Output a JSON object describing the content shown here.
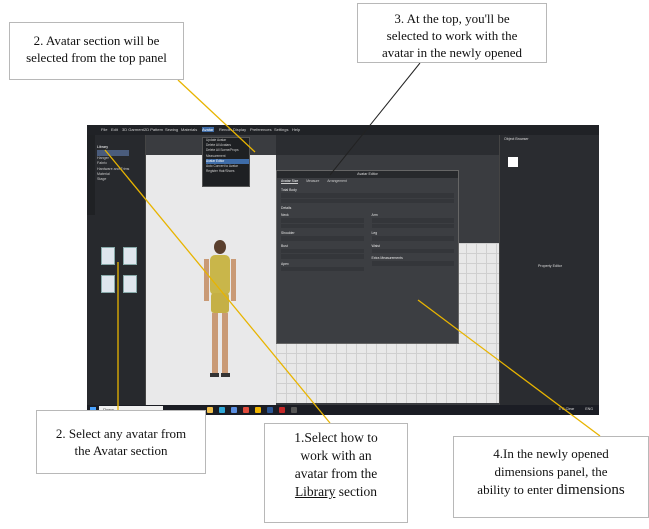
{
  "callouts": {
    "step2": {
      "line1": "2. Avatar section will be",
      "line2": "selected from the top panel"
    },
    "step3": {
      "line1": "3. At the top, you'll be",
      "line2": "selected to work with the",
      "line3": "avatar in the newly opened"
    },
    "select_avatar": {
      "line1": "2. Select any avatar from",
      "line2": "the Avatar section"
    },
    "step1": {
      "line1": "1.Select how to",
      "line2": "work with an",
      "line3": "avatar from the",
      "line4": "Library",
      "line5": "section"
    },
    "step4": {
      "line1": "4.In the newly opened",
      "line2": "dimensions panel, the",
      "line3a": "ability to enter",
      "line3b": "dimensions"
    }
  },
  "app": {
    "menu": [
      "File",
      "Edit",
      "3D Garment",
      "2D Pattern",
      "Sewing",
      "Materials",
      "Avatar",
      "Render",
      "Display",
      "Preferences",
      "Settings",
      "Help"
    ],
    "library_title": "Library",
    "library_items": [
      "Hanger",
      "Fabric",
      "Hardware and Trims",
      "Material",
      "Stage"
    ],
    "avatar_dropdown": [
      "Update Avatar",
      "Delete All Avatars",
      "Delete All Scene/Props",
      "Measurement",
      "Avatar Editor",
      "Auto Convert to Avatar",
      "Register Hair/Shoes"
    ],
    "dialog": {
      "title": "Avatar Editor",
      "tabs": [
        "Avatar Size",
        "Measure",
        "Arrangement"
      ],
      "sections": [
        "Total Body",
        "Details",
        "Neck",
        "Shoulder",
        "Leg",
        "Arm",
        "Bust",
        "Waist",
        "Extra Measurements",
        "Apex"
      ]
    },
    "right_panel_titles": [
      "Object Browser",
      "Property Editor"
    ],
    "taskbar": {
      "search_placeholder": "Поиск",
      "weather": "5°C Clear",
      "lang": "ENG"
    }
  }
}
